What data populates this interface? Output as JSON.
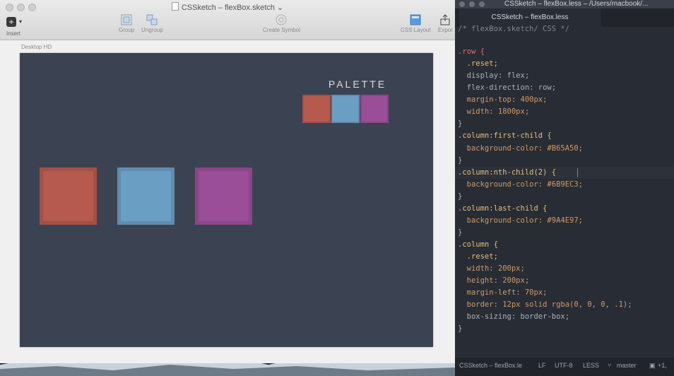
{
  "sketch_window": {
    "title": "CSSketch – flexBox.sketch",
    "title_caret": "⌄",
    "toolbar": {
      "insert_label": "Insert",
      "insert_symbol": "+",
      "group_label": "Group",
      "ungroup_label": "Ungroup",
      "create_symbol_label": "Create Symbol",
      "css_layout_label": "CSS Layout",
      "export_label": "Expor"
    },
    "artboard_label": "Desktop HD",
    "palette_title": "PALETTE",
    "colors": {
      "first": "#B65A50",
      "second": "#6B9EC3",
      "third": "#9A4E97",
      "artboard_bg": "#3B4353"
    }
  },
  "editor_window": {
    "title": "CSSketch – flexBox.less – /Users/macbook/...",
    "tab_label": "CSSketch – flexBox.less",
    "code_lines": [
      "/* flexBox.sketch/ CSS */",
      ".row {",
      "  .reset;",
      "  display: flex;",
      "  flex-direction: row;",
      "  margin-top: 400px;",
      "  width: 1800px;",
      "}",
      ".column:first-child {",
      "  background-color: #B65A50;",
      "}",
      ".column:nth-child(2) {",
      "  background-color: #6B9EC3;",
      "}",
      ".column:last-child {",
      "  background-color: #9A4E97;",
      "}",
      ".column {",
      "  .reset;",
      "  width: 200px;",
      "  height: 200px;",
      "  margin-left: 70px;",
      "  border: 12px solid rgba(0, 0, 0, .1);",
      "  box-sizing: border-box;",
      "}"
    ],
    "status_bar": {
      "file": "CSSketch – flexBox.le",
      "line_ending": "LF",
      "encoding": "UTF-8",
      "grammar": "LESS",
      "branch": "master",
      "git_status": "+1,"
    }
  }
}
